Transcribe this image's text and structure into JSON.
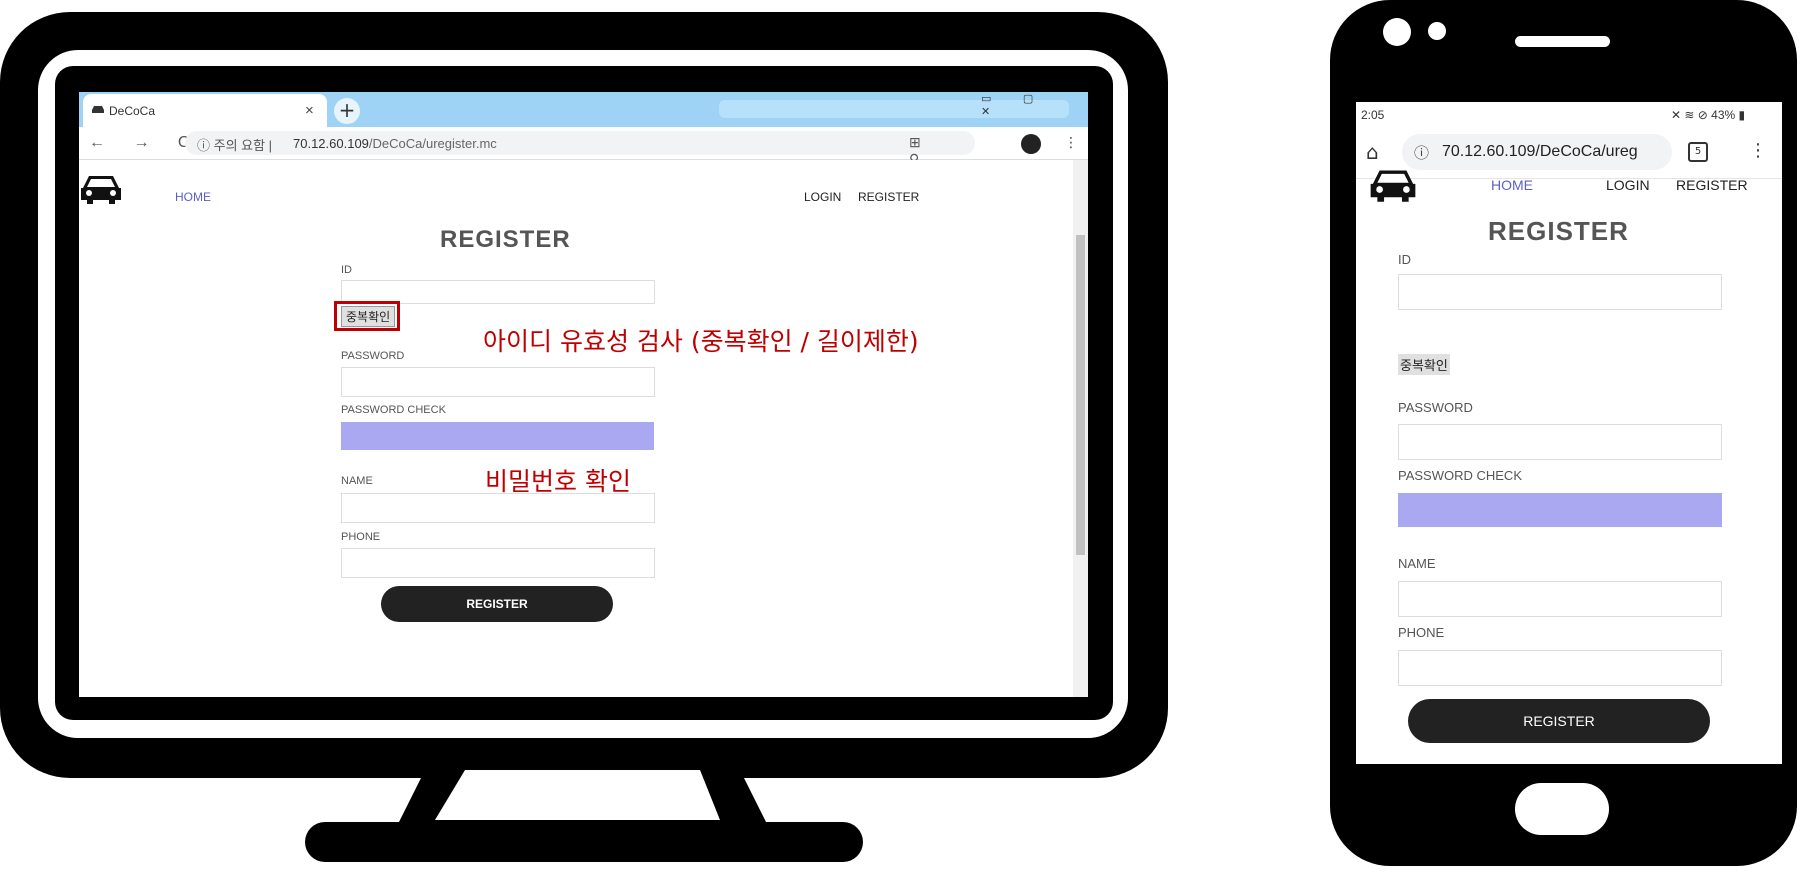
{
  "desktop": {
    "tab": {
      "title": "DeCoCa",
      "close": "×",
      "new_tab": "+"
    },
    "address": {
      "nav_icons": "← → C",
      "security_label": "ⓘ 주의 요함 |",
      "url_host": "70.12.60.109",
      "url_path": "/DeCoCa/uregister.mc",
      "right_icons": "⊞ ⚲ ☆",
      "menu": "⋮"
    },
    "nav": {
      "home": "HOME",
      "login": "LOGIN",
      "register": "REGISTER"
    },
    "form": {
      "title": "REGISTER",
      "id_label": "ID",
      "dup_check": "중복확인",
      "password_label": "PASSWORD",
      "password_check_label": "PASSWORD CHECK",
      "name_label": "NAME",
      "phone_label": "PHONE",
      "submit": "REGISTER"
    },
    "annotations": {
      "id_check": "아이디 유효성 검사 (중복확인 / 길이제한)",
      "password_check": "비밀번호 확인"
    }
  },
  "mobile": {
    "status": {
      "time": "2:05",
      "icons": "✕ ≋ ⊘ 43% ▮"
    },
    "address": {
      "home_icon": "⌂",
      "security": "ⓘ",
      "url": "70.12.60.109/DeCoCa/ureg",
      "tabs": "5",
      "menu": "⋮"
    },
    "nav": {
      "home": "HOME",
      "login": "LOGIN",
      "register": "REGISTER"
    },
    "form": {
      "title": "REGISTER",
      "id_label": "ID",
      "dup_check": "중복확인",
      "password_label": "PASSWORD",
      "password_check_label": "PASSWORD CHECK",
      "name_label": "NAME",
      "phone_label": "PHONE",
      "submit": "REGISTER"
    }
  },
  "colors": {
    "accent_nav": "#5b5fc7",
    "password_check_fill": "#a9a8f0",
    "annotation": "#c00000",
    "button": "#222222"
  }
}
